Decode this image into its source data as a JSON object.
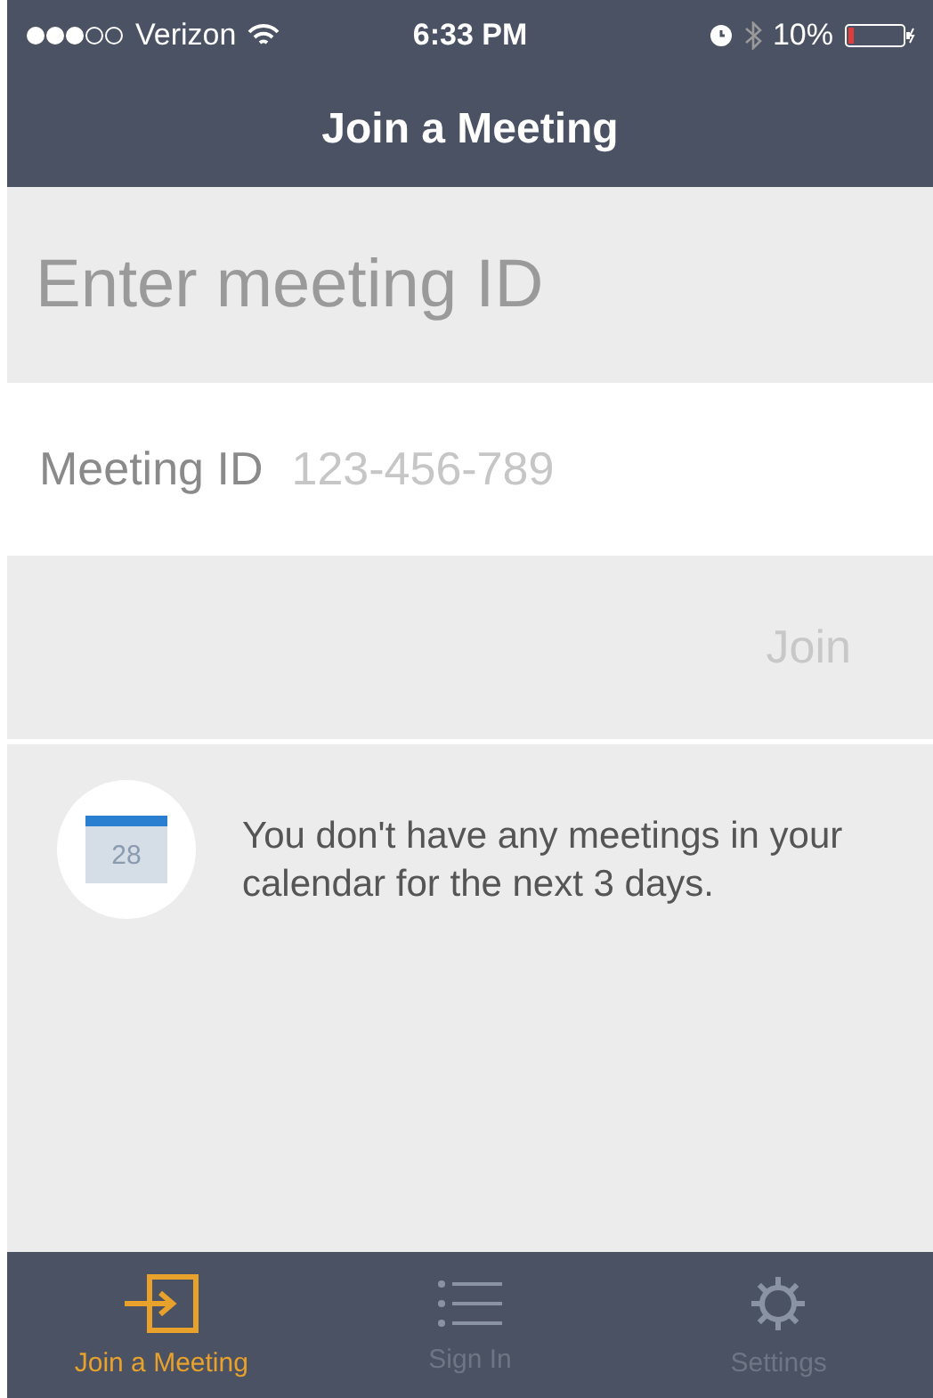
{
  "status_bar": {
    "carrier": "Verizon",
    "time": "6:33 PM",
    "battery": "10%"
  },
  "nav": {
    "title": "Join a Meeting"
  },
  "form": {
    "heading": "Enter meeting ID",
    "field_label": "Meeting ID",
    "placeholder": "123-456-789",
    "button": "Join",
    "disabled": true
  },
  "notice": {
    "day": "28",
    "text": "You don't have any meetings in your calendar for the next 3 days."
  },
  "tabs": [
    {
      "kind": "join",
      "label": "Join a Meeting",
      "selected": true
    },
    {
      "kind": "list",
      "label": "Sign In",
      "selected": false
    },
    {
      "kind": "gear",
      "label": "Settings",
      "selected": false
    }
  ]
}
